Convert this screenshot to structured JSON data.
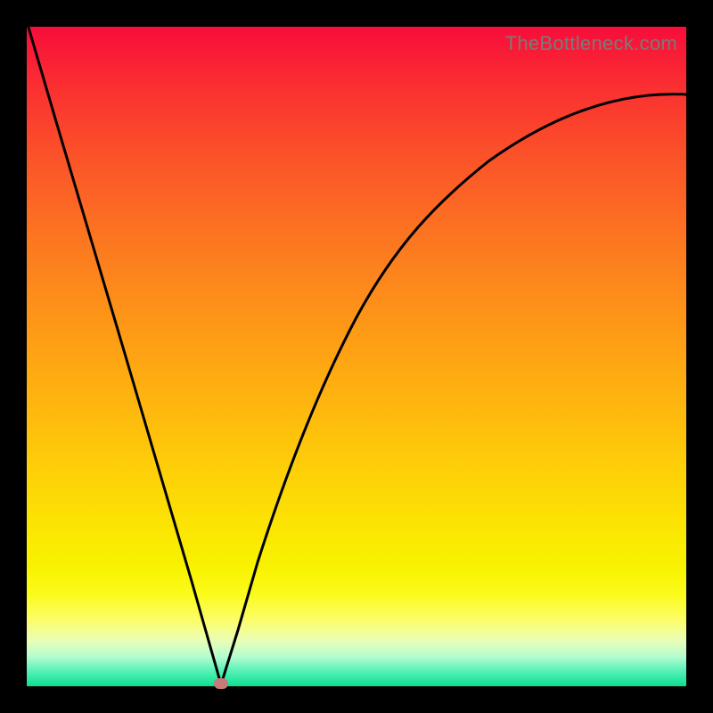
{
  "watermark": "TheBottleneck.com",
  "chart_data": {
    "type": "line",
    "title": "",
    "xlabel": "",
    "ylabel": "",
    "xlim": [
      0,
      1
    ],
    "ylim": [
      0,
      1
    ],
    "background_gradient": {
      "top": "#f70d3a",
      "bottom": "#0be08f",
      "description": "red (top) through orange and yellow to green (bottom)"
    },
    "marker": {
      "x": 0.295,
      "y": 0.0,
      "color": "#c77a7a"
    },
    "series": [
      {
        "name": "curve",
        "x": [
          0.0,
          0.05,
          0.1,
          0.15,
          0.2,
          0.25,
          0.295,
          0.32,
          0.35,
          0.4,
          0.45,
          0.5,
          0.56,
          0.62,
          0.7,
          0.8,
          0.9,
          1.0
        ],
        "y": [
          1.0,
          0.83,
          0.661,
          0.492,
          0.322,
          0.153,
          0.0,
          0.085,
          0.188,
          0.345,
          0.465,
          0.56,
          0.65,
          0.715,
          0.778,
          0.832,
          0.87,
          0.897
        ]
      }
    ]
  }
}
